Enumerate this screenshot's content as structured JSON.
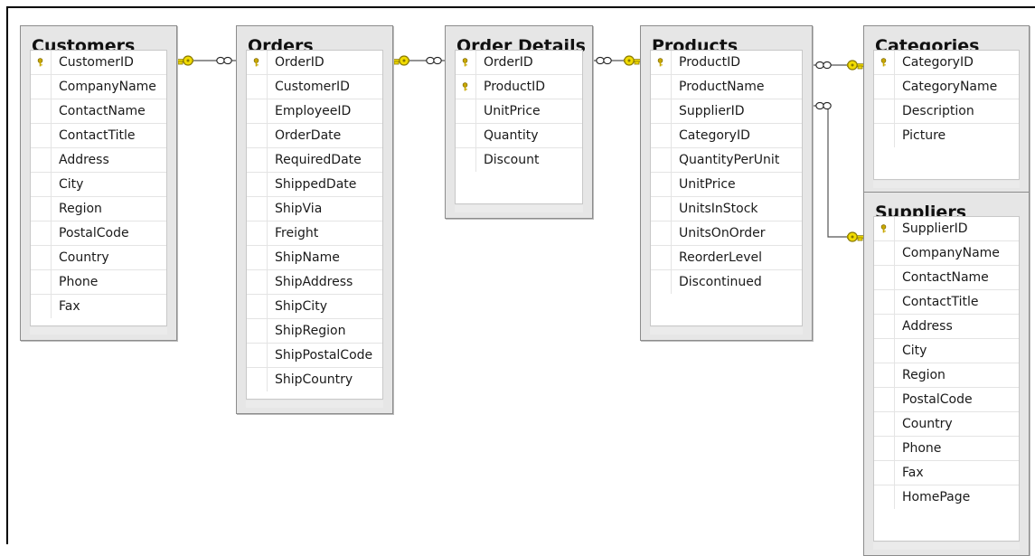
{
  "tables": [
    {
      "id": "customers",
      "title": "Customers",
      "columns": [
        {
          "name": "CustomerID",
          "pk": true
        },
        {
          "name": "CompanyName"
        },
        {
          "name": "ContactName"
        },
        {
          "name": "ContactTitle"
        },
        {
          "name": "Address"
        },
        {
          "name": "City"
        },
        {
          "name": "Region"
        },
        {
          "name": "PostalCode"
        },
        {
          "name": "Country"
        },
        {
          "name": "Phone"
        },
        {
          "name": "Fax"
        }
      ]
    },
    {
      "id": "orders",
      "title": "Orders",
      "columns": [
        {
          "name": "OrderID",
          "pk": true
        },
        {
          "name": "CustomerID"
        },
        {
          "name": "EmployeeID"
        },
        {
          "name": "OrderDate"
        },
        {
          "name": "RequiredDate"
        },
        {
          "name": "ShippedDate"
        },
        {
          "name": "ShipVia"
        },
        {
          "name": "Freight"
        },
        {
          "name": "ShipName"
        },
        {
          "name": "ShipAddress"
        },
        {
          "name": "ShipCity"
        },
        {
          "name": "ShipRegion"
        },
        {
          "name": "ShipPostalCode"
        },
        {
          "name": "ShipCountry"
        }
      ]
    },
    {
      "id": "order-details",
      "title": "Order Details",
      "columns": [
        {
          "name": "OrderID",
          "pk": true
        },
        {
          "name": "ProductID",
          "pk": true
        },
        {
          "name": "UnitPrice"
        },
        {
          "name": "Quantity"
        },
        {
          "name": "Discount"
        }
      ]
    },
    {
      "id": "products",
      "title": "Products",
      "columns": [
        {
          "name": "ProductID",
          "pk": true
        },
        {
          "name": "ProductName"
        },
        {
          "name": "SupplierID"
        },
        {
          "name": "CategoryID"
        },
        {
          "name": "QuantityPerUnit"
        },
        {
          "name": "UnitPrice"
        },
        {
          "name": "UnitsInStock"
        },
        {
          "name": "UnitsOnOrder"
        },
        {
          "name": "ReorderLevel"
        },
        {
          "name": "Discontinued"
        }
      ]
    },
    {
      "id": "categories",
      "title": "Categories",
      "columns": [
        {
          "name": "CategoryID",
          "pk": true
        },
        {
          "name": "CategoryName"
        },
        {
          "name": "Description"
        },
        {
          "name": "Picture"
        }
      ]
    },
    {
      "id": "suppliers",
      "title": "Suppliers",
      "columns": [
        {
          "name": "SupplierID",
          "pk": true
        },
        {
          "name": "CompanyName"
        },
        {
          "name": "ContactName"
        },
        {
          "name": "ContactTitle"
        },
        {
          "name": "Address"
        },
        {
          "name": "City"
        },
        {
          "name": "Region"
        },
        {
          "name": "PostalCode"
        },
        {
          "name": "Country"
        },
        {
          "name": "Phone"
        },
        {
          "name": "Fax"
        },
        {
          "name": "HomePage"
        }
      ]
    }
  ],
  "relationships": [
    {
      "one": "customers",
      "many": "orders"
    },
    {
      "one": "orders",
      "many": "order-details"
    },
    {
      "one": "products",
      "many": "order-details"
    },
    {
      "one": "categories",
      "many": "products"
    },
    {
      "one": "suppliers",
      "many": "products"
    }
  ],
  "colors": {
    "key": "#f2dc00",
    "key_outline": "#8a7a00",
    "pk_icon": "#c9a800",
    "connector": "#555555"
  }
}
